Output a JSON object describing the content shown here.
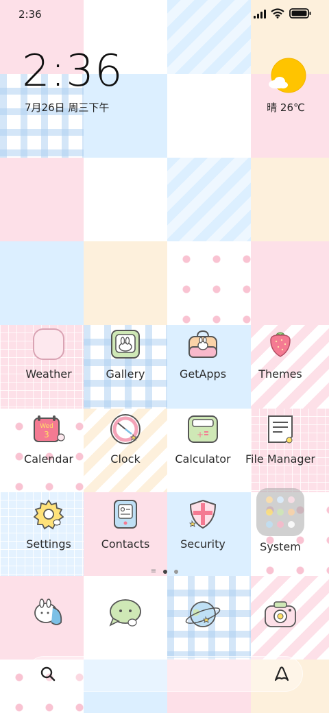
{
  "status_bar": {
    "time": "2:36",
    "battery": "battery-full-icon",
    "wifi": "wifi-icon",
    "signal": "signal-icon"
  },
  "clock_widget": {
    "time": "2:36",
    "date": "7月26日 周三下午"
  },
  "weather_widget": {
    "icon": "sun-cloud-icon",
    "text": "晴 26℃"
  },
  "apps": [
    {
      "label": "Weather",
      "icon": "weather-icon"
    },
    {
      "label": "Gallery",
      "icon": "gallery-icon"
    },
    {
      "label": "GetApps",
      "icon": "getapps-icon"
    },
    {
      "label": "Themes",
      "icon": "themes-icon"
    },
    {
      "label": "Calendar",
      "icon": "calendar-icon",
      "icon_text": "Wed",
      "icon_day": "3"
    },
    {
      "label": "Clock",
      "icon": "clock-icon"
    },
    {
      "label": "Calculator",
      "icon": "calculator-icon"
    },
    {
      "label": "File Manager",
      "icon": "file-manager-icon"
    },
    {
      "label": "Settings",
      "icon": "settings-icon"
    },
    {
      "label": "Contacts",
      "icon": "contacts-icon"
    },
    {
      "label": "Security",
      "icon": "security-icon"
    },
    {
      "label": "System",
      "icon": "folder-icon"
    }
  ],
  "page_indicator": {
    "pages": 2,
    "current": 1
  },
  "dock": [
    {
      "icon": "phone-icon"
    },
    {
      "icon": "messages-icon"
    },
    {
      "icon": "browser-icon"
    },
    {
      "icon": "camera-icon"
    }
  ],
  "search_bar": {
    "left_icon": "search-icon",
    "right_icon": "assistant-icon"
  },
  "colors": {
    "pink": "#fde0e8",
    "blue": "#dcefff",
    "cream": "#fdf0dc",
    "sun": "#ffc400"
  }
}
